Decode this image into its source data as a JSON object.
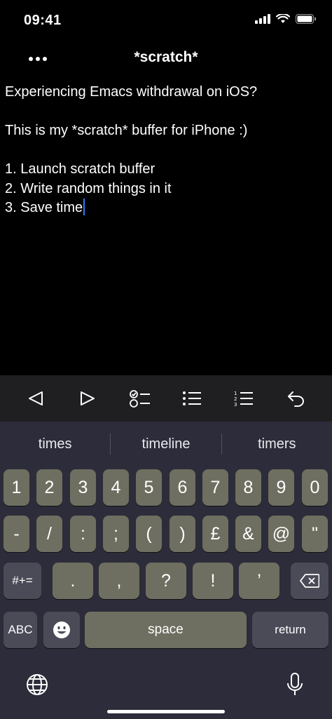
{
  "status_bar": {
    "time": "09:41"
  },
  "nav": {
    "title": "*scratch*"
  },
  "editor": {
    "lines": [
      "Experiencing Emacs withdrawal on iOS?",
      "",
      "This is my *scratch* buffer for iPhone :)",
      "",
      "1. Launch scratch buffer",
      "2. Write random things in it",
      "3. Save time"
    ]
  },
  "toolbar": {
    "icons": [
      "arrow-left-icon",
      "arrow-right-icon",
      "checklist-icon",
      "bullet-list-icon",
      "numbered-list-icon",
      "undo-icon"
    ]
  },
  "keyboard": {
    "suggestions": [
      "times",
      "timeline",
      "timers"
    ],
    "row1": [
      "1",
      "2",
      "3",
      "4",
      "5",
      "6",
      "7",
      "8",
      "9",
      "0"
    ],
    "row2": [
      "-",
      "/",
      ":",
      ";",
      "(",
      ")",
      "£",
      "&",
      "@",
      "\""
    ],
    "row3_left": "#+=",
    "row3": [
      ".",
      ",",
      "?",
      "!",
      "’"
    ],
    "row4": {
      "abc": "ABC",
      "space": "space",
      "return": "return"
    }
  },
  "colors": {
    "caret": "#2f7bf6",
    "key": "#6e6f60",
    "key_dark": "#4a4b57",
    "keyboard_bg": "#2c2c3a",
    "toolbar_bg": "#1f1f22"
  }
}
